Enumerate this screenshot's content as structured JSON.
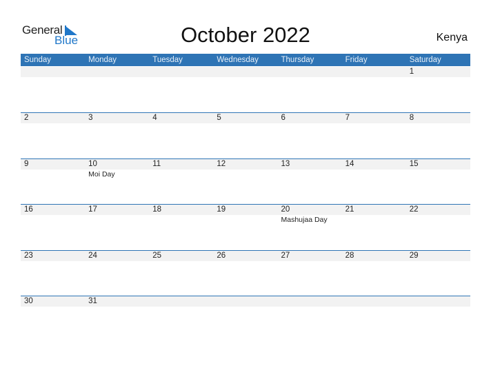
{
  "logo": {
    "line1": "General",
    "line2": "Blue"
  },
  "title": "October 2022",
  "country": "Kenya",
  "colors": {
    "header_bg": "#2e74b5",
    "accent": "#1f77c9",
    "date_strip": "#f2f2f2"
  },
  "weekdays": [
    "Sunday",
    "Monday",
    "Tuesday",
    "Wednesday",
    "Thursday",
    "Friday",
    "Saturday"
  ],
  "weeks": [
    {
      "days": [
        {
          "num": "",
          "event": ""
        },
        {
          "num": "",
          "event": ""
        },
        {
          "num": "",
          "event": ""
        },
        {
          "num": "",
          "event": ""
        },
        {
          "num": "",
          "event": ""
        },
        {
          "num": "",
          "event": ""
        },
        {
          "num": "1",
          "event": ""
        }
      ]
    },
    {
      "days": [
        {
          "num": "2",
          "event": ""
        },
        {
          "num": "3",
          "event": ""
        },
        {
          "num": "4",
          "event": ""
        },
        {
          "num": "5",
          "event": ""
        },
        {
          "num": "6",
          "event": ""
        },
        {
          "num": "7",
          "event": ""
        },
        {
          "num": "8",
          "event": ""
        }
      ]
    },
    {
      "days": [
        {
          "num": "9",
          "event": ""
        },
        {
          "num": "10",
          "event": "Moi Day"
        },
        {
          "num": "11",
          "event": ""
        },
        {
          "num": "12",
          "event": ""
        },
        {
          "num": "13",
          "event": ""
        },
        {
          "num": "14",
          "event": ""
        },
        {
          "num": "15",
          "event": ""
        }
      ]
    },
    {
      "days": [
        {
          "num": "16",
          "event": ""
        },
        {
          "num": "17",
          "event": ""
        },
        {
          "num": "18",
          "event": ""
        },
        {
          "num": "19",
          "event": ""
        },
        {
          "num": "20",
          "event": "Mashujaa Day"
        },
        {
          "num": "21",
          "event": ""
        },
        {
          "num": "22",
          "event": ""
        }
      ]
    },
    {
      "days": [
        {
          "num": "23",
          "event": ""
        },
        {
          "num": "24",
          "event": ""
        },
        {
          "num": "25",
          "event": ""
        },
        {
          "num": "26",
          "event": ""
        },
        {
          "num": "27",
          "event": ""
        },
        {
          "num": "28",
          "event": ""
        },
        {
          "num": "29",
          "event": ""
        }
      ]
    },
    {
      "days": [
        {
          "num": "30",
          "event": ""
        },
        {
          "num": "31",
          "event": ""
        },
        {
          "num": "",
          "event": ""
        },
        {
          "num": "",
          "event": ""
        },
        {
          "num": "",
          "event": ""
        },
        {
          "num": "",
          "event": ""
        },
        {
          "num": "",
          "event": ""
        }
      ]
    }
  ]
}
